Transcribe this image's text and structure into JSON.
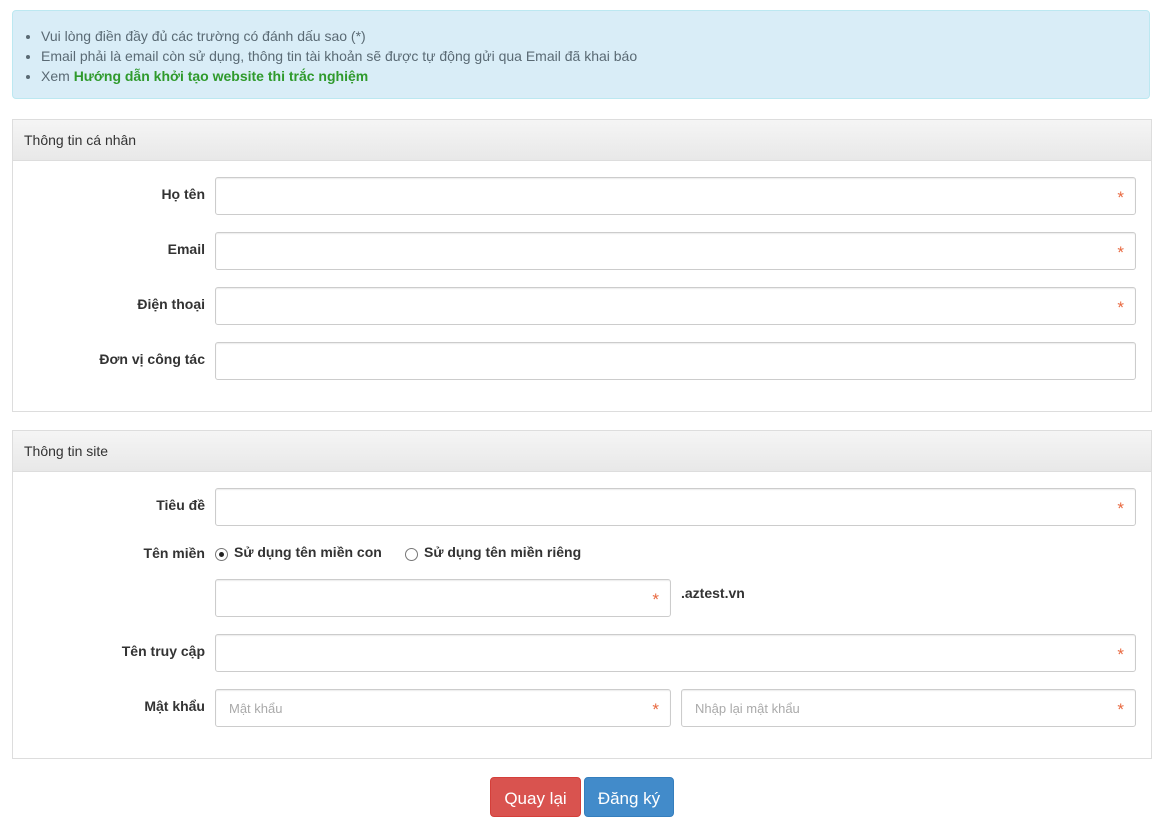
{
  "notice": {
    "items": [
      "Vui lòng điền đầy đủ các trường có đánh dấu sao (*)",
      "Email phải là email còn sử dụng, thông tin tài khoản sẽ được tự động gửi qua Email đã khai báo"
    ],
    "guide_prefix": "Xem ",
    "guide_link": "Hướng dẫn khởi tạo website thi trắc nghiệm"
  },
  "personal": {
    "heading": "Thông tin cá nhân",
    "fullname_label": "Họ tên",
    "email_label": "Email",
    "phone_label": "Điện thoại",
    "org_label": "Đơn vị công tác"
  },
  "site": {
    "heading": "Thông tin site",
    "title_label": "Tiêu đề",
    "domain_label": "Tên miền",
    "domain_option_sub": "Sử dụng tên miền con",
    "domain_option_own": "Sử dụng tên miền riêng",
    "domain_selected": "Sử dụng tên miền con",
    "domain_suffix": ".aztest.vn",
    "username_label": "Tên truy cập",
    "password_label": "Mật khẩu",
    "password_placeholder": "Mật khẩu",
    "password_confirm_placeholder": "Nhập lại mật khẩu"
  },
  "required_mark": "*",
  "buttons": {
    "back": "Quay lại",
    "submit": "Đăng ký"
  },
  "colors": {
    "notice_bg": "#d9edf7",
    "link": "#2f9a2c",
    "required": "#e8683f",
    "back_button": "#d9534f",
    "submit_button": "#428bca"
  }
}
